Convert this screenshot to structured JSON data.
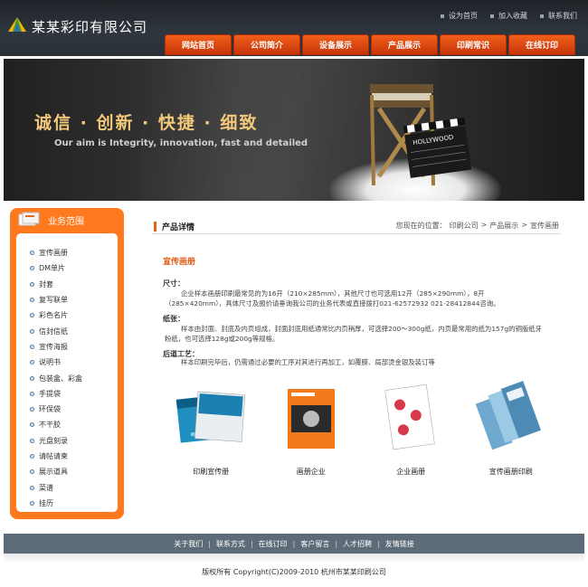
{
  "header": {
    "brand": "某某彩印有限公司",
    "top_links": [
      "设为首页",
      "加入收藏",
      "联系我们"
    ],
    "nav": [
      "网站首页",
      "公司简介",
      "设备展示",
      "产品展示",
      "印刷常识",
      "在线订印"
    ]
  },
  "banner": {
    "slogan": "诚信 · 创新 · 快捷 · 细致",
    "slogan_en": "Our aim is Integrity, innovation, fast and detailed",
    "clapper_text": "HOLLYWOOD"
  },
  "sidebar": {
    "title": "业务范围",
    "items": [
      "宣传画册",
      "DM单片",
      "封套",
      "复写联单",
      "彩色名片",
      "信封信纸",
      "宣传海报",
      "说明书",
      "包装盒、彩盒",
      "手提袋",
      "环保袋",
      "不干胶",
      "光盘刻录",
      "请帖请柬",
      "展示道具",
      "菜谱",
      "挂历"
    ]
  },
  "content": {
    "title": "产品详情",
    "breadcrumb_prefix": "您现在的位置：",
    "breadcrumb": [
      "印刷公司",
      "产品展示",
      "宣传画册"
    ],
    "breadcrumb_sep": ">",
    "product_name": "宣传画册",
    "size_label": "尺寸：",
    "size_text": "企业样本画册印刷最常见的为16开（210×285mm），其他尺寸也可选用12开（285×290mm），8开（285×420mm），具体尺寸及报价请垂询我公司的业务代表或直接拨打021-62572932 021-28412844咨询。",
    "paper_label": "纸张：",
    "paper_text": "样本由封面、封底及内页组成，封面封底用纸通常比内页稍厚，可选择200～300g纸，内页最常用的纸为157g的铜版纸牙粉纸，也可选择128g或200g等规格。",
    "post_label": "后道工艺：",
    "post_text": "样本印刷完毕后，仍需通过必要的工序对其进行再加工，如覆膜、局部烫金银及装订等",
    "products": [
      "印刷宣传册",
      "画册企业",
      "企业画册",
      "宣传画册印刷"
    ]
  },
  "footer": {
    "links": [
      "关于我们",
      "联系方式",
      "在线订印",
      "客户留言",
      "人才招聘",
      "友情链接"
    ],
    "separator": "|",
    "copyright": "版权所有  Copyright(C)2009-2010 杭州市某某印刷公司"
  },
  "colors": {
    "accent": "#ff7a1f",
    "nav_red": "#d8400e",
    "header_bg": "#2a3036",
    "footer_bg": "#5d6b78"
  }
}
